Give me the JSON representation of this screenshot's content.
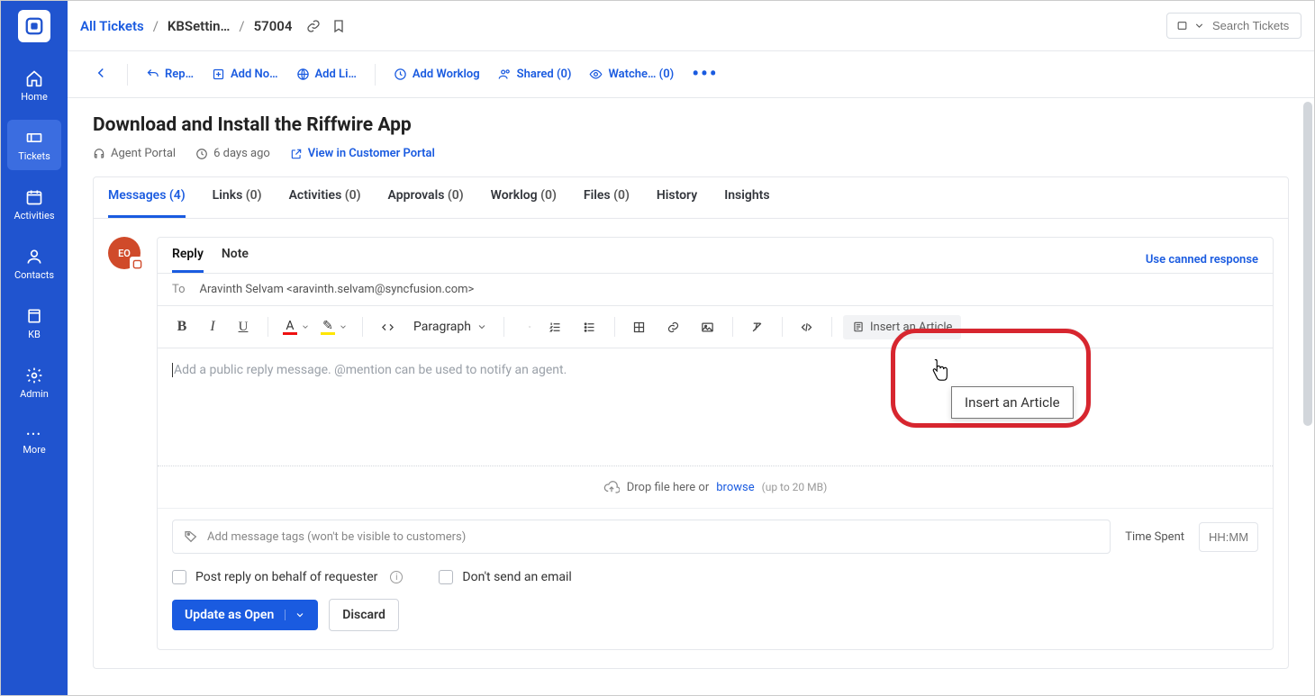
{
  "sidebar": {
    "items": [
      {
        "label": "Home"
      },
      {
        "label": "Tickets"
      },
      {
        "label": "Activities"
      },
      {
        "label": "Contacts"
      },
      {
        "label": "KB"
      },
      {
        "label": "Admin"
      },
      {
        "label": "More"
      }
    ]
  },
  "breadcrumb": {
    "root": "All Tickets",
    "mid": "KBSettin…",
    "id": "57004"
  },
  "search": {
    "placeholder": "Search Tickets"
  },
  "actions": {
    "reply": "Rep…",
    "add_note": "Add No…",
    "add_link": "Add Li…",
    "add_worklog": "Add Worklog",
    "shared": "Shared (0)",
    "watchers": "Watche… (0)"
  },
  "ticket": {
    "title": "Download and Install the Riffwire App",
    "portal": "Agent Portal",
    "age": "6 days ago",
    "view_portal": "View in Customer Portal"
  },
  "tabs": [
    {
      "label": "Messages",
      "count": "(4)"
    },
    {
      "label": "Links",
      "count": "(0)"
    },
    {
      "label": "Activities",
      "count": "(0)"
    },
    {
      "label": "Approvals",
      "count": "(0)"
    },
    {
      "label": "Worklog",
      "count": "(0)"
    },
    {
      "label": "Files",
      "count": "(0)"
    },
    {
      "label": "History",
      "count": ""
    },
    {
      "label": "Insights",
      "count": ""
    }
  ],
  "avatar": {
    "initials": "EO"
  },
  "compose": {
    "reply_tab": "Reply",
    "note_tab": "Note",
    "canned": "Use canned response",
    "to_label": "To",
    "to_value": "Aravinth Selvam <aravinth.selvam@syncfusion.com>",
    "paragraph": "Paragraph",
    "insert_article": "Insert an Article",
    "placeholder": "Add a public reply message. @mention can be used to notify an agent.",
    "drop_text": "Drop file here or",
    "browse": "browse",
    "drop_hint": "(up to 20 MB)",
    "tags_placeholder": "Add message tags (won't be visible to customers)",
    "time_spent": "Time Spent",
    "time_placeholder": "HH:MM",
    "post_behalf": "Post reply on behalf of requester",
    "dont_send": "Don't send an email",
    "update_btn": "Update as Open",
    "discard_btn": "Discard"
  },
  "tooltip": {
    "text": "Insert an Article"
  }
}
